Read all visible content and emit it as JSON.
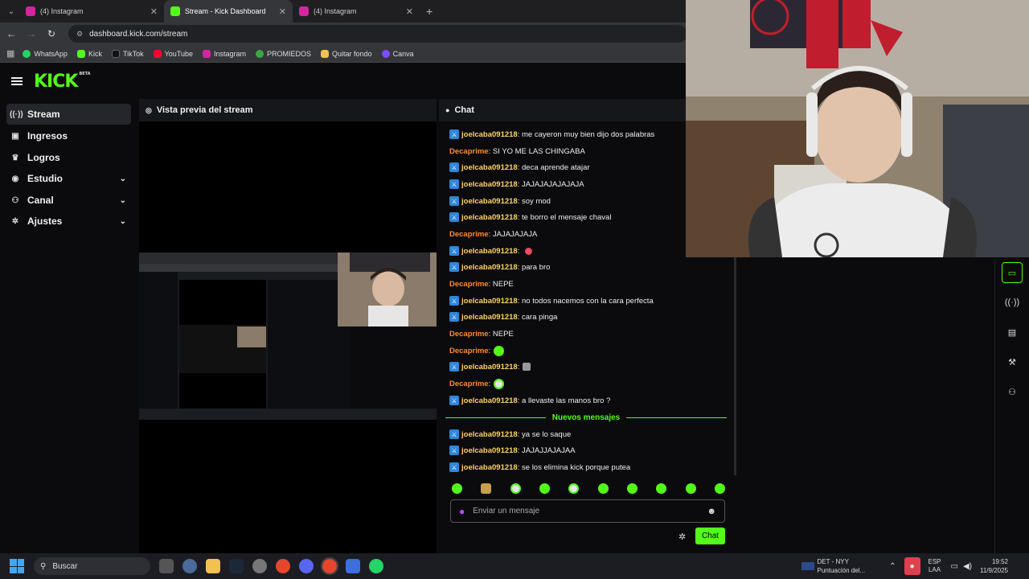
{
  "browser": {
    "tabs": [
      {
        "label": "(4) Instagram",
        "active": false
      },
      {
        "label": "Stream - Kick Dashboard",
        "active": true
      },
      {
        "label": "(4) Instagram",
        "active": false
      }
    ],
    "url": "dashboard.kick.com/stream",
    "bookmarks": [
      "WhatsApp",
      "Kick",
      "TikTok",
      "YouTube",
      "Instagram",
      "PROMIEDOS",
      "Quitar fondo",
      "Canva"
    ]
  },
  "app": {
    "logo": "KICK",
    "logo_badge": "BETA"
  },
  "sidebar": {
    "items": [
      {
        "label": "Stream",
        "icon": "broadcast-icon"
      },
      {
        "label": "Ingresos",
        "icon": "wallet-icon"
      },
      {
        "label": "Logros",
        "icon": "trophy-icon"
      },
      {
        "label": "Estudio",
        "icon": "studio-icon"
      },
      {
        "label": "Canal",
        "icon": "channel-icon"
      },
      {
        "label": "Ajustes",
        "icon": "gear-icon"
      }
    ]
  },
  "preview": {
    "title": "Vista previa del stream"
  },
  "chat": {
    "title": "Chat",
    "messages": [
      {
        "user": "joelcaba091218",
        "text": "me cayeron muy bien dijo dos palabras"
      },
      {
        "user": "Decaprime",
        "text": "SI YO ME LAS CHINGABA"
      },
      {
        "user": "joelcaba091218",
        "text": "deca aprende atajar"
      },
      {
        "user": "joelcaba091218",
        "text": "JAJAJAJAJAJAJA"
      },
      {
        "user": "joelcaba091218",
        "text": "soy mod"
      },
      {
        "user": "joelcaba091218",
        "text": "te borro el mensaje chaval"
      },
      {
        "user": "Decaprime",
        "text": "JAJAJAJAJA"
      },
      {
        "user": "joelcaba091218",
        "text": ""
      },
      {
        "user": "joelcaba091218",
        "text": "para bro"
      },
      {
        "user": "Decaprime",
        "text": "NEPE"
      },
      {
        "user": "joelcaba091218",
        "text": "no todos nacemos con la cara perfecta"
      },
      {
        "user": "joelcaba091218",
        "text": "cara pinga"
      },
      {
        "user": "Decaprime",
        "text": "NEPE"
      },
      {
        "user": "Decaprime",
        "text": ""
      },
      {
        "user": "joelcaba091218",
        "text": ""
      },
      {
        "user": "Decaprime",
        "text": ""
      },
      {
        "user": "joelcaba091218",
        "text": "a llevaste las manos bro ?"
      }
    ],
    "new_messages_label": "Nuevos mensajes",
    "new_messages": [
      {
        "user": "joelcaba091218",
        "text": "ya se lo saque"
      },
      {
        "user": "joelcaba091218",
        "text": "JAJAJJAJAJAA"
      },
      {
        "user": "joelcaba091218",
        "text": "se los elimina kick porque putea"
      }
    ],
    "input_placeholder": "Enviar un mensaje",
    "send_label": "Chat"
  },
  "taskbar": {
    "search_label": "Buscar",
    "score_title": "DET - NYY",
    "score_sub": "Puntuación del...",
    "lang_top": "ESP",
    "lang_bottom": "LAA",
    "time": "19:52",
    "date": "11/9/2025"
  }
}
